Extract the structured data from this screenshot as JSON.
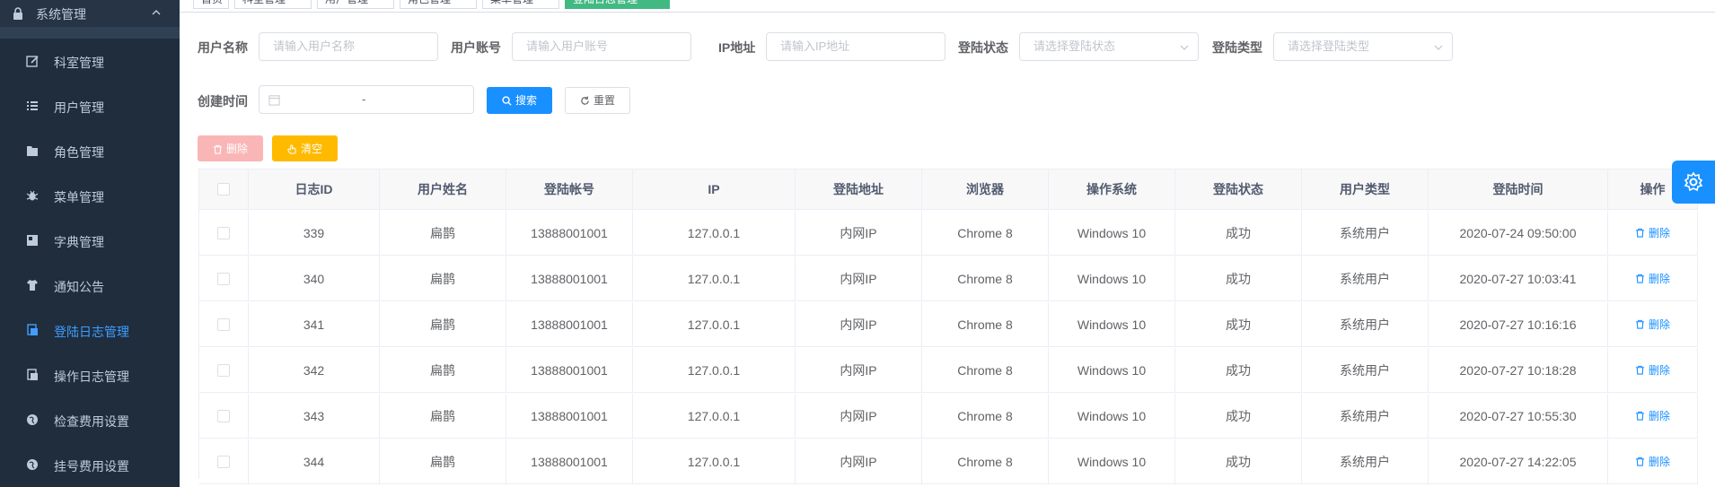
{
  "sidebar": {
    "group_label": "系统管理",
    "items": [
      {
        "label": "科室管理",
        "icon": "edit-icon"
      },
      {
        "label": "用户管理",
        "icon": "list-icon"
      },
      {
        "label": "角色管理",
        "icon": "folder-icon"
      },
      {
        "label": "菜单管理",
        "icon": "bug-icon"
      },
      {
        "label": "字典管理",
        "icon": "dict-icon"
      },
      {
        "label": "通知公告",
        "icon": "shirt-icon"
      },
      {
        "label": "登陆日志管理",
        "icon": "log-icon",
        "active": true
      },
      {
        "label": "操作日志管理",
        "icon": "log-icon"
      },
      {
        "label": "检查费用设置",
        "icon": "globe-icon"
      },
      {
        "label": "挂号费用设置",
        "icon": "globe-icon"
      }
    ]
  },
  "tags": [
    {
      "label": "首页"
    },
    {
      "label": "科室管理"
    },
    {
      "label": "用户管理"
    },
    {
      "label": "角色管理"
    },
    {
      "label": "菜单管理"
    },
    {
      "label": "登陆日志管理",
      "active": true
    }
  ],
  "search": {
    "username_label": "用户名称",
    "username_placeholder": "请输入用户名称",
    "account_label": "用户账号",
    "account_placeholder": "请输入用户账号",
    "ip_label": "IP地址",
    "ip_placeholder": "请输入IP地址",
    "status_label": "登陆状态",
    "status_placeholder": "请选择登陆状态",
    "type_label": "登陆类型",
    "type_placeholder": "请选择登陆类型",
    "time_label": "创建时间",
    "time_separator": "-",
    "search_button": "搜索",
    "reset_button": "重置"
  },
  "toolbar": {
    "delete_button": "删除",
    "clear_button": "清空"
  },
  "table": {
    "columns": [
      "日志ID",
      "用户姓名",
      "登陆帐号",
      "IP",
      "登陆地址",
      "浏览器",
      "操作系统",
      "登陆状态",
      "用户类型",
      "登陆时间",
      "操作"
    ],
    "delete_link": "删除",
    "rows": [
      [
        "339",
        "扁鹊",
        "13888001001",
        "127.0.0.1",
        "内网IP",
        "Chrome 8",
        "Windows 10",
        "成功",
        "系统用户",
        "2020-07-24 09:50:00"
      ],
      [
        "340",
        "扁鹊",
        "13888001001",
        "127.0.0.1",
        "内网IP",
        "Chrome 8",
        "Windows 10",
        "成功",
        "系统用户",
        "2020-07-27 10:03:41"
      ],
      [
        "341",
        "扁鹊",
        "13888001001",
        "127.0.0.1",
        "内网IP",
        "Chrome 8",
        "Windows 10",
        "成功",
        "系统用户",
        "2020-07-27 10:16:16"
      ],
      [
        "342",
        "扁鹊",
        "13888001001",
        "127.0.0.1",
        "内网IP",
        "Chrome 8",
        "Windows 10",
        "成功",
        "系统用户",
        "2020-07-27 10:18:28"
      ],
      [
        "343",
        "扁鹊",
        "13888001001",
        "127.0.0.1",
        "内网IP",
        "Chrome 8",
        "Windows 10",
        "成功",
        "系统用户",
        "2020-07-27 10:55:30"
      ],
      [
        "344",
        "扁鹊",
        "13888001001",
        "127.0.0.1",
        "内网IP",
        "Chrome 8",
        "Windows 10",
        "成功",
        "系统用户",
        "2020-07-27 14:22:05"
      ]
    ]
  },
  "colors": {
    "sidebar_bg": "#304156",
    "primary": "#1890ff",
    "active_text": "#409eff",
    "warning": "#ffba00",
    "danger_light": "#fab6b6"
  }
}
